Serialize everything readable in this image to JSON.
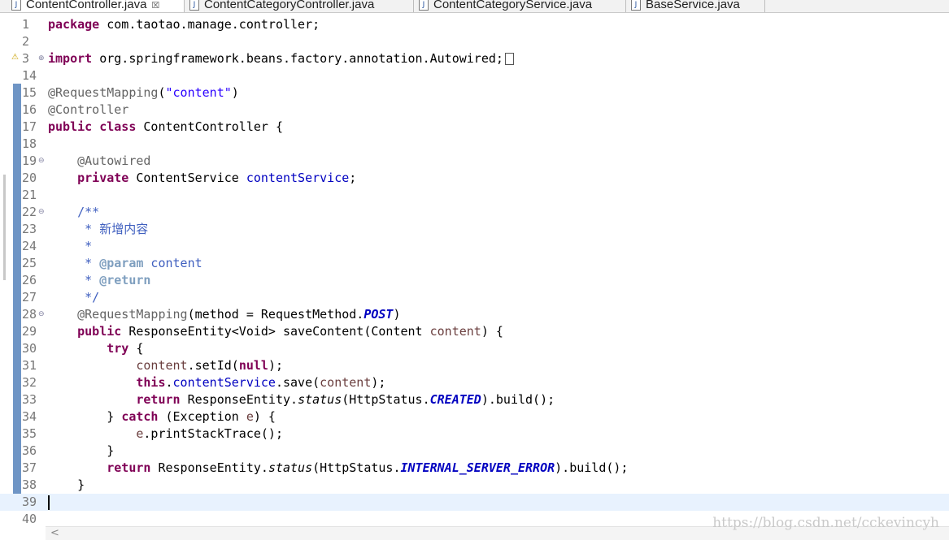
{
  "tabs": [
    {
      "label": "ContentController.java",
      "active": true,
      "close": "☒"
    },
    {
      "label": "ContentCategoryController.java",
      "active": false
    },
    {
      "label": "ContentCategoryService.java",
      "active": false
    },
    {
      "label": "BaseService.java",
      "active": false
    }
  ],
  "file_icon": "java-file-icon",
  "lines": [
    {
      "n": "1"
    },
    {
      "n": "2"
    },
    {
      "n": "3"
    },
    {
      "n": "14"
    },
    {
      "n": "15"
    },
    {
      "n": "16"
    },
    {
      "n": "17"
    },
    {
      "n": "18"
    },
    {
      "n": "19"
    },
    {
      "n": "20"
    },
    {
      "n": "21"
    },
    {
      "n": "22"
    },
    {
      "n": "23"
    },
    {
      "n": "24"
    },
    {
      "n": "25"
    },
    {
      "n": "26"
    },
    {
      "n": "27"
    },
    {
      "n": "28"
    },
    {
      "n": "29"
    },
    {
      "n": "30"
    },
    {
      "n": "31"
    },
    {
      "n": "32"
    },
    {
      "n": "33"
    },
    {
      "n": "34"
    },
    {
      "n": "35"
    },
    {
      "n": "36"
    },
    {
      "n": "37"
    },
    {
      "n": "38"
    },
    {
      "n": "39"
    },
    {
      "n": "40"
    }
  ],
  "code": {
    "l1": {
      "kw": "package",
      "rest": " com.taotao.manage.controller;"
    },
    "l3": {
      "kw": "import",
      "rest": " org.springframework.beans.factory.annotation.Autowired;"
    },
    "l15": {
      "ann": "@RequestMapping",
      "open": "(",
      "str": "\"content\"",
      "close": ")"
    },
    "l16": {
      "ann": "@Controller"
    },
    "l17": {
      "kw1": "public",
      "kw2": "class",
      "rest": " ContentController {"
    },
    "l19": {
      "ann": "@Autowired"
    },
    "l20": {
      "kw": "private",
      "type": " ContentService ",
      "fld": "contentService",
      "end": ";"
    },
    "l22": {
      "doc": "/**"
    },
    "l23": {
      "doc": " * 新增内容"
    },
    "l24": {
      "doc": " *"
    },
    "l25": {
      "doc": " * ",
      "tag": "@param",
      "rest": " content"
    },
    "l26": {
      "doc": " * ",
      "tag": "@return"
    },
    "l27": {
      "doc": " */"
    },
    "l28": {
      "ann": "@RequestMapping",
      "a": "(method = RequestMethod.",
      "cnst": "POST",
      "b": ")"
    },
    "l29": {
      "kw": "public",
      "a": " ResponseEntity<Void> saveContent(Content ",
      "prm": "content",
      "b": ") {"
    },
    "l30": {
      "kw": "try",
      "rest": " {"
    },
    "l31": {
      "fld": "content",
      "a": ".setId(",
      "kw": "null",
      "b": ");"
    },
    "l32": {
      "kw": "this",
      "a": ".",
      "fld": "contentService",
      "b": ".save(",
      "prm": "content",
      "c": ");"
    },
    "l33": {
      "kw": "return",
      "a": " ResponseEntity.",
      "it": "status",
      "b": "(HttpStatus.",
      "cnst": "CREATED",
      "c": ").build();"
    },
    "l34": {
      "a": "} ",
      "kw": "catch",
      "b": " (Exception ",
      "prm": "e",
      "c": ") {"
    },
    "l35": {
      "prm": "e",
      "a": ".printStackTrace();"
    },
    "l36": {
      "a": "}"
    },
    "l37": {
      "kw": "return",
      "a": " ResponseEntity.",
      "it": "status",
      "b": "(HttpStatus.",
      "cnst": "INTERNAL_SERVER_ERROR",
      "c": ").build();"
    },
    "l38": {
      "a": "}"
    }
  },
  "fold_minus": "⊖",
  "fold_plus": "⊕",
  "scroll_arrow": "<",
  "watermark": "https://blog.csdn.net/cckevincyh",
  "colors": {
    "keyword": "#7f0055",
    "string": "#2a00ff",
    "annotation": "#646464",
    "field": "#0000c0",
    "javadoc": "#3f5fbf",
    "current_line": "#e8f2fe"
  }
}
